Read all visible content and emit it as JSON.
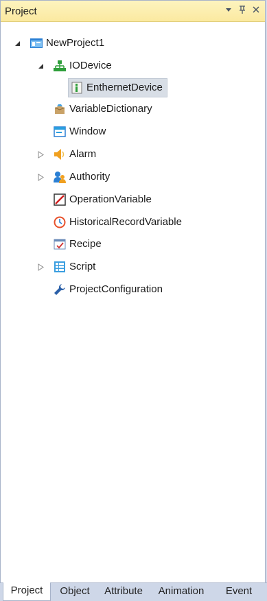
{
  "panel": {
    "title": "Project",
    "dropdown_glyph": "▾",
    "pin_glyph": "⊥",
    "close_glyph": "×"
  },
  "tree": {
    "root": {
      "label": "NewProject1",
      "expanded": true,
      "icon": "project-icon"
    },
    "io_device": {
      "label": "IODevice",
      "expanded": true,
      "icon": "network-icon"
    },
    "ethernet_device": {
      "label": "EnthernetDevice",
      "selected": true,
      "icon": "device-icon"
    },
    "variable_dictionary": {
      "label": "VariableDictionary",
      "icon": "dictionary-icon"
    },
    "window": {
      "label": "Window",
      "icon": "window-icon"
    },
    "alarm": {
      "label": "Alarm",
      "expanded": false,
      "icon": "speaker-icon"
    },
    "authority": {
      "label": "Authority",
      "expanded": false,
      "icon": "users-icon"
    },
    "operation_variable": {
      "label": "OperationVariable",
      "icon": "operation-icon"
    },
    "historical_record_variable": {
      "label": "HistoricalRecordVariable",
      "icon": "clock-icon"
    },
    "recipe": {
      "label": "Recipe",
      "icon": "recipe-icon"
    },
    "script": {
      "label": "Script",
      "expanded": false,
      "icon": "script-icon"
    },
    "project_configuration": {
      "label": "ProjectConfiguration",
      "icon": "wrench-icon"
    }
  },
  "tabs": [
    {
      "label": "Project",
      "active": true
    },
    {
      "label": "Object",
      "active": false
    },
    {
      "label": "Attribute",
      "active": false
    },
    {
      "label": "Animation",
      "active": false
    },
    {
      "label": "Event",
      "active": false
    }
  ],
  "colors": {
    "title_bg": "#fbe9a0",
    "selection_bg": "#d8dee6",
    "tab_bar_bg": "#ced7e8"
  }
}
